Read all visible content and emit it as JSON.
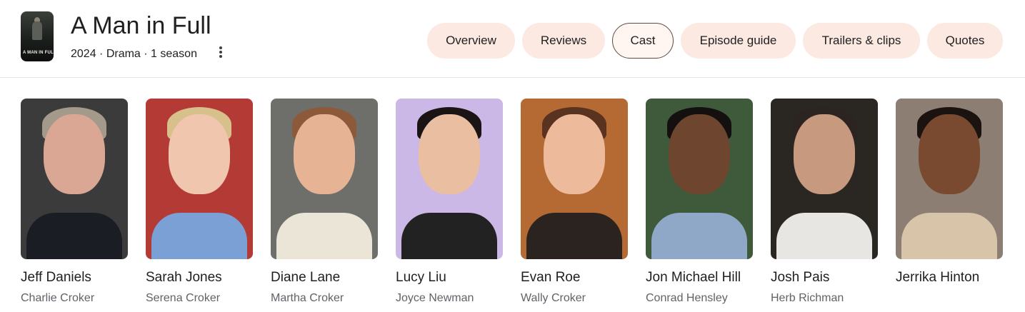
{
  "show": {
    "title": "A Man in Full",
    "subtitle": "2024 · Drama · 1 season",
    "poster_text": "A MAN IN FULL",
    "more_icon": "more-vert-icon"
  },
  "tabs": [
    {
      "label": "Overview",
      "active": false
    },
    {
      "label": "Reviews",
      "active": false
    },
    {
      "label": "Cast",
      "active": true
    },
    {
      "label": "Episode guide",
      "active": false
    },
    {
      "label": "Trailers & clips",
      "active": false
    },
    {
      "label": "Quotes",
      "active": false
    }
  ],
  "colors": {
    "tab_bg": "#fbe9e2",
    "tab_active_border": "#5f4a45",
    "role_text": "#5f6368"
  },
  "cast": [
    {
      "name": "Jeff Daniels",
      "role": "Charlie Croker",
      "bg": "#3b3b3b",
      "skin": "#d9a793",
      "hair": "#a49a8c",
      "shirt": "#1a1d24"
    },
    {
      "name": "Sarah Jones",
      "role": "Serena Croker",
      "bg": "#b43a36",
      "skin": "#f0c6ae",
      "hair": "#d8c08c",
      "shirt": "#7aa0d6"
    },
    {
      "name": "Diane Lane",
      "role": "Martha Croker",
      "bg": "#6e6e6a",
      "skin": "#e6b395",
      "hair": "#8c5a3a",
      "shirt": "#ebe5d8"
    },
    {
      "name": "Lucy Liu",
      "role": "Joyce Newman",
      "bg": "#cbb8e6",
      "skin": "#e9bea1",
      "hair": "#1b1414",
      "shirt": "#222222"
    },
    {
      "name": "Evan Roe",
      "role": "Wally Croker",
      "bg": "#b46a32",
      "skin": "#edbb9c",
      "hair": "#5a3220",
      "shirt": "#2a2320"
    },
    {
      "name": "Jon Michael Hill",
      "role": "Conrad Hensley",
      "bg": "#3f5a3a",
      "skin": "#6e4630",
      "hair": "#141010",
      "shirt": "#8fa8c8"
    },
    {
      "name": "Josh Pais",
      "role": "Herb Richman",
      "bg": "#2a2622",
      "skin": "#c79a80",
      "hair": "#2b2420",
      "shirt": "#e8e6e2"
    },
    {
      "name": "Jerrika Hinton",
      "role": "",
      "bg": "#8d7e74",
      "skin": "#7a4a30",
      "hair": "#1a1310",
      "shirt": "#d8c4a8"
    }
  ]
}
